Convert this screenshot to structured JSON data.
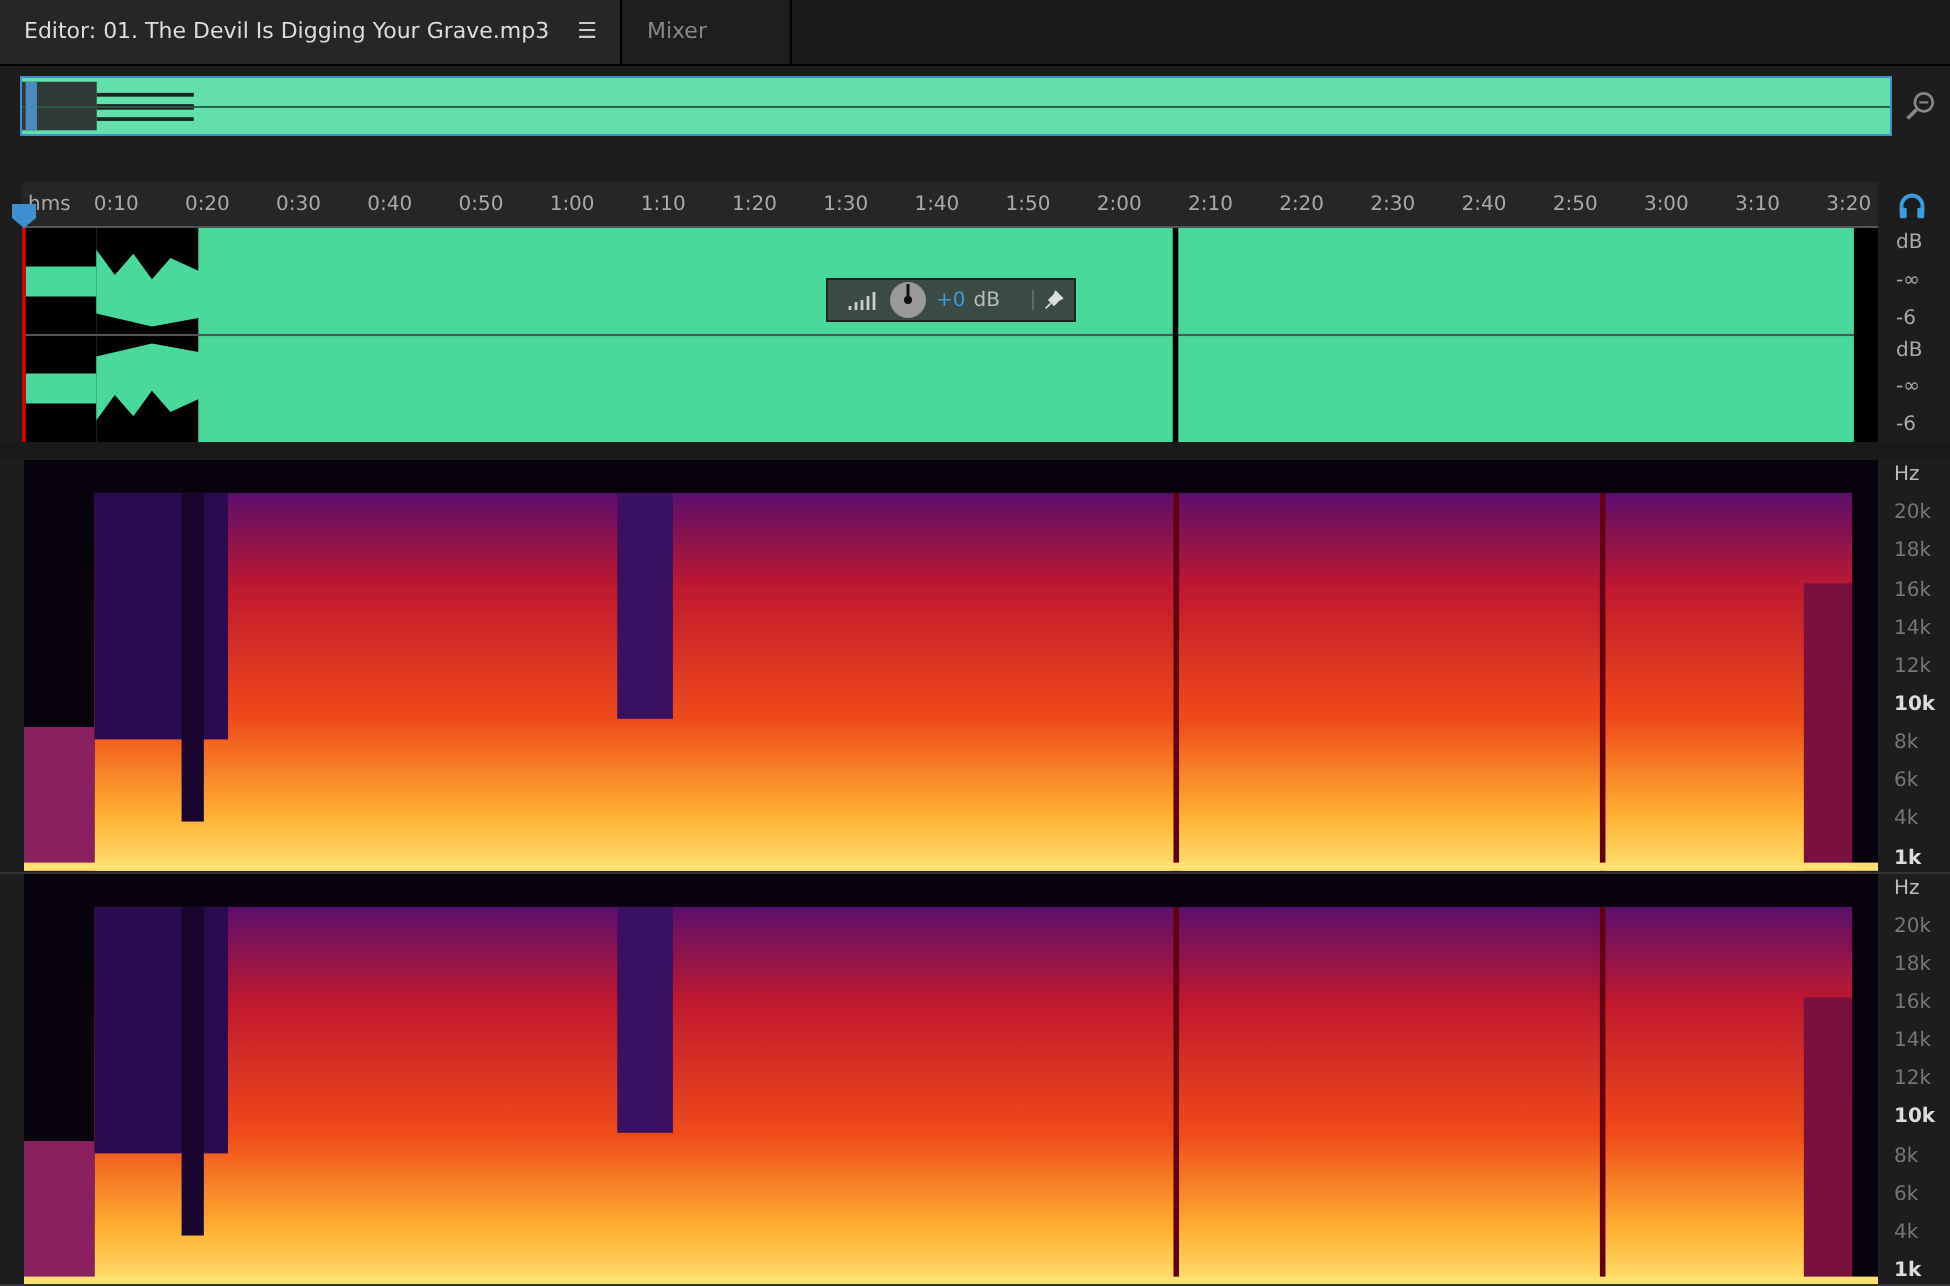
{
  "tabs": [
    {
      "label": "Editor: 01. The Devil Is Digging Your Grave.mp3",
      "selected": true,
      "menu_icon": "☰"
    },
    {
      "label": "Mixer",
      "selected": false
    }
  ],
  "ruler": {
    "unit": "hms",
    "labels": [
      "0:10",
      "0:20",
      "0:30",
      "0:40",
      "0:50",
      "1:00",
      "1:10",
      "1:20",
      "1:30",
      "1:40",
      "1:50",
      "2:00",
      "2:10",
      "2:20",
      "2:30",
      "2:40",
      "2:50",
      "3:00",
      "3:10",
      "3:20"
    ]
  },
  "channels": [
    {
      "scale": [
        "dB",
        "-∞",
        "-6"
      ]
    },
    {
      "scale": [
        "dB",
        "-∞",
        "-6"
      ]
    }
  ],
  "gain_hud": {
    "value": "+0",
    "unit": "dB"
  },
  "spectral_channels": [
    {
      "unit": "Hz",
      "ticks": [
        {
          "label": "20k",
          "bold": false
        },
        {
          "label": "18k",
          "bold": false
        },
        {
          "label": "16k",
          "bold": false
        },
        {
          "label": "14k",
          "bold": false
        },
        {
          "label": "12k",
          "bold": false
        },
        {
          "label": "10k",
          "bold": true
        },
        {
          "label": "8k",
          "bold": false
        },
        {
          "label": "6k",
          "bold": false
        },
        {
          "label": "4k",
          "bold": false
        },
        {
          "label": "1k",
          "bold": true
        }
      ]
    },
    {
      "unit": "Hz",
      "ticks": [
        {
          "label": "20k",
          "bold": false
        },
        {
          "label": "18k",
          "bold": false
        },
        {
          "label": "16k",
          "bold": false
        },
        {
          "label": "14k",
          "bold": false
        },
        {
          "label": "12k",
          "bold": false
        },
        {
          "label": "10k",
          "bold": true
        },
        {
          "label": "8k",
          "bold": false
        },
        {
          "label": "6k",
          "bold": false
        },
        {
          "label": "4k",
          "bold": false
        },
        {
          "label": "1k",
          "bold": true
        }
      ]
    }
  ]
}
